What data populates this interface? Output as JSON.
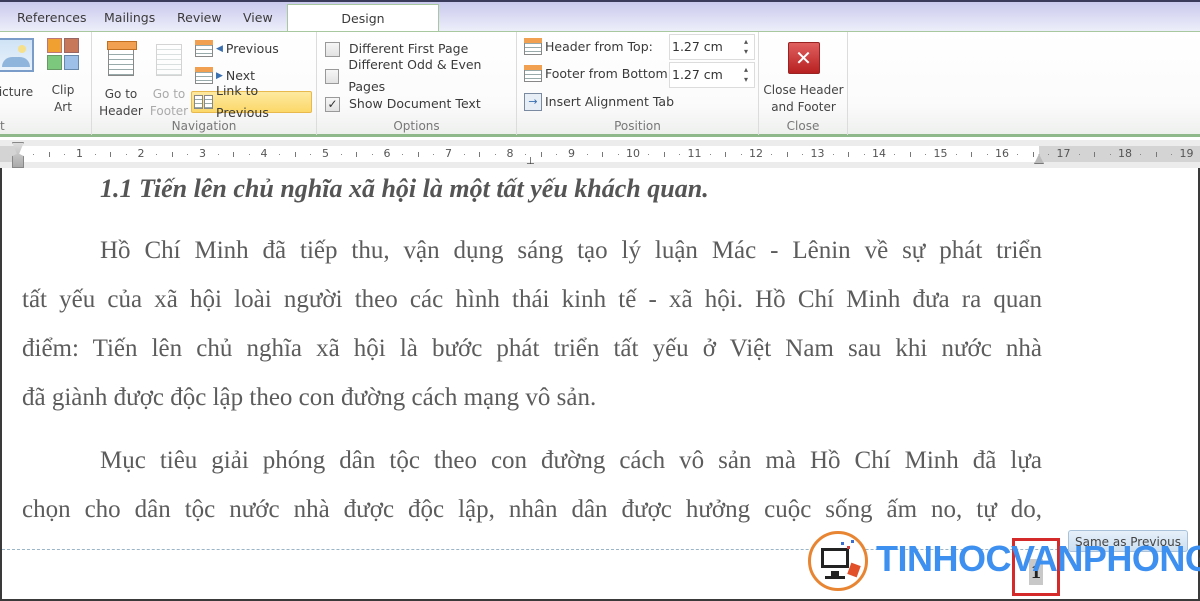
{
  "tabs": [
    {
      "label": "References",
      "active": false
    },
    {
      "label": "Mailings",
      "active": false
    },
    {
      "label": "Review",
      "active": false
    },
    {
      "label": "View",
      "active": false
    },
    {
      "label": "Design",
      "active": true
    }
  ],
  "ribbon": {
    "insert_group": {
      "label": "t",
      "picture_label": "icture",
      "clipart_label_1": "Clip",
      "clipart_label_2": "Art"
    },
    "navigation": {
      "label": "Navigation",
      "go_to_header_1": "Go to",
      "go_to_header_2": "Header",
      "go_to_footer_1": "Go to",
      "go_to_footer_2": "Footer",
      "previous": "Previous",
      "next": "Next",
      "link_to_previous": "Link to Previous",
      "link_to_previous_active": true
    },
    "options": {
      "label": "Options",
      "different_first_page": {
        "label": "Different First Page",
        "checked": false
      },
      "different_odd_even": {
        "label": "Different Odd & Even Pages",
        "checked": false
      },
      "show_document_text": {
        "label": "Show Document Text",
        "checked": true
      }
    },
    "position": {
      "label": "Position",
      "header_from_top_label": "Header from Top:",
      "header_from_top_value": "1.27 cm",
      "footer_from_bottom_label": "Footer from Bottom:",
      "footer_from_bottom_value": "1.27 cm",
      "insert_alignment_tab": "Insert Alignment Tab"
    },
    "close": {
      "label": "Close",
      "close_btn_1": "Close Header",
      "close_btn_2": "and Footer"
    }
  },
  "ruler": {
    "numbers": [
      "1",
      "2",
      "3",
      "4",
      "5",
      "6",
      "7",
      "8",
      "9",
      "10",
      "11",
      "12",
      "13",
      "14",
      "15",
      "16",
      "17",
      "18",
      "19"
    ]
  },
  "document": {
    "heading": "1.1 Tiến lên chủ nghĩa xã hội là một tất yếu khách quan.",
    "paragraph1_lines": [
      "Hồ Chí Minh đã tiếp thu, vận dụng sáng tạo lý luận Mác - Lênin về sự phát triển",
      "tất yếu của xã hội loài người theo các hình thái kinh tế - xã hội. Hồ Chí Minh đưa ra quan",
      "điểm: Tiến lên chủ nghĩa xã hội là bước phát triển tất yếu ở Việt Nam sau khi nước nhà",
      "đã giành được độc lập theo con đường cách mạng vô sản."
    ],
    "paragraph2_lines": [
      "Mục tiêu giải phóng dân tộc theo con đường cách vô sản mà Hồ Chí Minh đã lựa",
      "chọn cho dân tộc nước nhà được độc lập, nhân dân được hưởng cuộc sống ấm no, tự do,"
    ],
    "same_as_previous": "Same as Previous",
    "page_number": "1"
  },
  "watermark": {
    "text": "TINHOCVANPHONG",
    "color": "#3d8ff0",
    "ring_color": "#e88533"
  }
}
